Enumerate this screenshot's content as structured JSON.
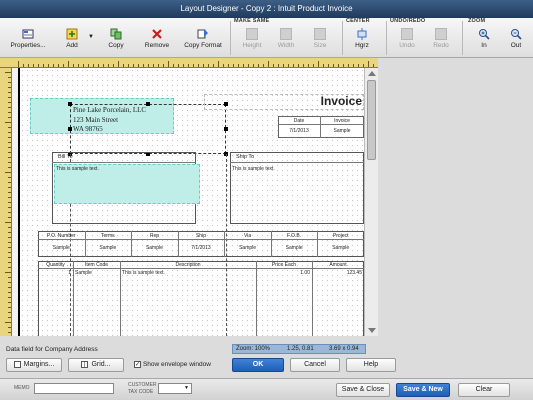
{
  "window": {
    "title": "Layout Designer - Copy 2 : Intuit Product Invoice"
  },
  "toolbar": {
    "groups": {
      "make_same": "MAKE SAME",
      "center": "CENTER",
      "undo_redo": "UNDO/REDO",
      "zoom": "ZOOM"
    },
    "buttons": {
      "properties": "Properties...",
      "add": "Add",
      "copy": "Copy",
      "remove": "Remove",
      "copy_format": "Copy Format",
      "height": "Height",
      "width": "Width",
      "size": "Size",
      "horz": "Hgrz",
      "undo": "Undo",
      "redo": "Redo",
      "zoom_in": "In",
      "zoom_out": "Out"
    }
  },
  "invoice": {
    "company_name": "Pine Lake Porcelain, LLC",
    "address_line1": "123 Main Street",
    "address_line2": "WA 98765",
    "title": "Invoice",
    "date_header": "Date",
    "invoice_header": "Invoice",
    "date_value": "7/1/2013",
    "invoice_value": "Sample",
    "bill_to_label": "Bill To",
    "ship_to_label": "Ship To",
    "bill_to_text": "This is sample text.",
    "ship_to_text": "This is sample text.",
    "info_headers": [
      "P.O. Number",
      "Terms",
      "Rep",
      "Ship",
      "Via",
      "F.O.B.",
      "Project"
    ],
    "info_values": [
      "Sample",
      "Sample",
      "Sample",
      "7/1/2013",
      "Sample",
      "Sample",
      "Sample"
    ],
    "item_headers": [
      "Quantity",
      "Item Code",
      "Description",
      "Price Each",
      "Amount"
    ],
    "item_row": {
      "qty": "1",
      "item": "Sample",
      "desc": "This is sample text.",
      "price": "1.00",
      "amount": "123.45"
    }
  },
  "status": {
    "zoom": "Zoom: 100%",
    "position": "1.25, 0.81",
    "size": "3.69 x 0.94",
    "selection_text": "Data field for Company Address",
    "margins_button": "Margins...",
    "grid_button": "Grid...",
    "show_envelope": "Show envelope window",
    "show_envelope_checked": true,
    "ok_button": "OK",
    "cancel_button": "Cancel",
    "help_button": "Help"
  },
  "bottom": {
    "memo_label": "MEMO",
    "customer_tax_label1": "CUSTOMER",
    "customer_tax_label2": "TAX CODE",
    "save_close": "Save & Close",
    "save_new": "Save & New",
    "clear": "Clear"
  },
  "colors": {
    "accent": "#1f5fb4",
    "ruler": "#e9d57e",
    "selection": "#bfeee8"
  }
}
